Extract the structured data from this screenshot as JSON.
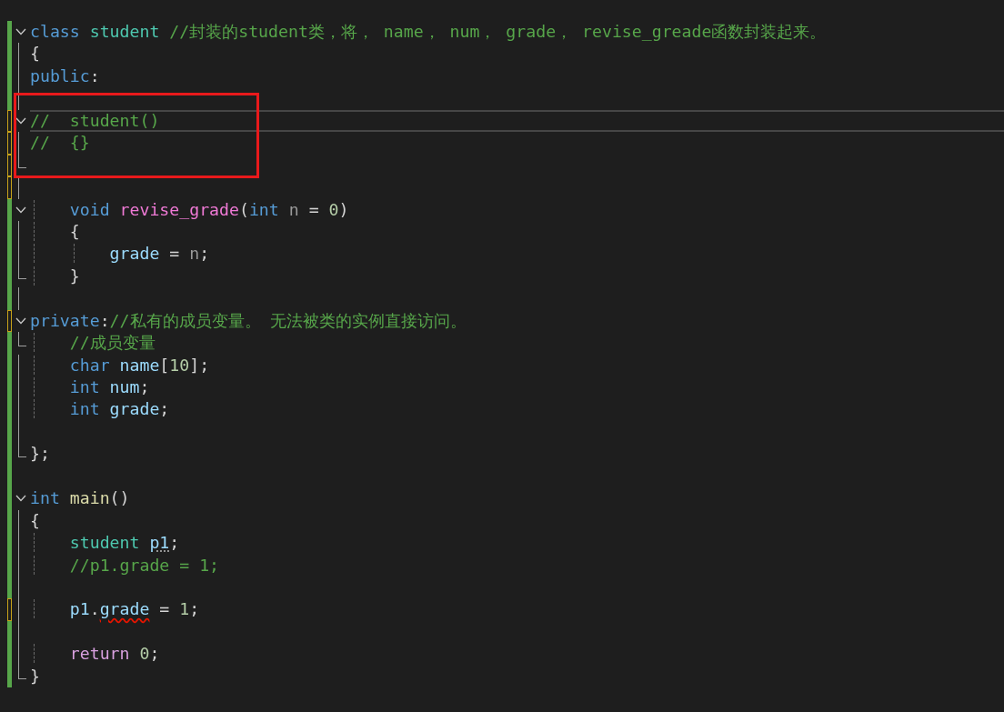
{
  "editor": {
    "lines": [
      {
        "kind": "head",
        "modified": false,
        "tokens": [
          {
            "text": "class",
            "kind": "keyword"
          },
          {
            "text": " student",
            "kind": "type"
          },
          {
            "text": " //封装的student类，将， name， num， grade， revise_greade函数封装起来。",
            "kind": "comment"
          }
        ]
      },
      {
        "kind": "body",
        "modified": false,
        "tokens": [
          {
            "text": "{",
            "kind": "punct"
          }
        ]
      },
      {
        "kind": "body",
        "modified": false,
        "tokens": [
          {
            "text": "public",
            "kind": "keyword"
          },
          {
            "text": ":",
            "kind": "punct"
          }
        ]
      },
      {
        "kind": "body",
        "modified": false,
        "boxed": true
      },
      {
        "kind": "head",
        "modified": true,
        "boxed": true,
        "current": true,
        "tokens": [
          {
            "text": "//  student()",
            "kind": "comment"
          }
        ]
      },
      {
        "kind": "body",
        "modified": true,
        "boxed": true,
        "tokens": [
          {
            "text": "//  {}",
            "kind": "comment"
          }
        ]
      },
      {
        "kind": "tail",
        "modified": true,
        "boxed": true
      },
      {
        "kind": "body",
        "modified": true
      },
      {
        "kind": "head",
        "modified": false,
        "tokens": [
          {
            "text": "    void",
            "kind": "keyword"
          },
          {
            "text": " revise_grade",
            "kind": "function"
          },
          {
            "text": "(",
            "kind": "punct"
          },
          {
            "text": "int",
            "kind": "keyword"
          },
          {
            "text": " n",
            "kind": "param"
          },
          {
            "text": " = ",
            "kind": "punct"
          },
          {
            "text": "0",
            "kind": "number"
          },
          {
            "text": ")",
            "kind": "punct"
          }
        ]
      },
      {
        "kind": "body",
        "modified": false,
        "tokens": [
          {
            "text": "    {",
            "kind": "punct"
          }
        ]
      },
      {
        "kind": "body",
        "modified": false,
        "tokens": [
          {
            "text": "        grade",
            "kind": "variable"
          },
          {
            "text": " = ",
            "kind": "punct"
          },
          {
            "text": "n",
            "kind": "param"
          },
          {
            "text": ";",
            "kind": "punct"
          }
        ]
      },
      {
        "kind": "tail",
        "modified": false,
        "tokens": [
          {
            "text": "    }",
            "kind": "punct"
          }
        ]
      },
      {
        "kind": "body",
        "modified": false
      },
      {
        "kind": "head",
        "modified": true,
        "tokens": [
          {
            "text": "private",
            "kind": "keyword"
          },
          {
            "text": ":",
            "kind": "punct"
          },
          {
            "text": "//私有的成员变量。 无法被类的实例直接访问。",
            "kind": "comment"
          }
        ]
      },
      {
        "kind": "tail",
        "modified": false,
        "tokens": [
          {
            "text": "    //成员变量",
            "kind": "comment"
          }
        ]
      },
      {
        "kind": "body",
        "modified": false,
        "tokens": [
          {
            "text": "    char",
            "kind": "keyword"
          },
          {
            "text": " name",
            "kind": "variable"
          },
          {
            "text": "[",
            "kind": "punct"
          },
          {
            "text": "10",
            "kind": "number"
          },
          {
            "text": "];",
            "kind": "punct"
          }
        ]
      },
      {
        "kind": "body",
        "modified": false,
        "tokens": [
          {
            "text": "    int",
            "kind": "keyword"
          },
          {
            "text": " num",
            "kind": "variable"
          },
          {
            "text": ";",
            "kind": "punct"
          }
        ]
      },
      {
        "kind": "body",
        "modified": false,
        "tokens": [
          {
            "text": "    int",
            "kind": "keyword"
          },
          {
            "text": " grade",
            "kind": "variable"
          },
          {
            "text": ";",
            "kind": "punct"
          }
        ]
      },
      {
        "kind": "body",
        "modified": false
      },
      {
        "kind": "tail",
        "modified": false,
        "tokens": [
          {
            "text": "};",
            "kind": "punct"
          }
        ]
      },
      {
        "kind": "plain",
        "modified": false
      },
      {
        "kind": "head",
        "modified": false,
        "tokens": [
          {
            "text": "int",
            "kind": "keyword"
          },
          {
            "text": " main",
            "kind": "method"
          },
          {
            "text": "()",
            "kind": "punct"
          }
        ]
      },
      {
        "kind": "body",
        "modified": false,
        "tokens": [
          {
            "text": "{",
            "kind": "punct"
          }
        ]
      },
      {
        "kind": "body",
        "modified": false,
        "tokens": [
          {
            "text": "    student ",
            "kind": "type"
          },
          {
            "text": "p1",
            "kind": "variable",
            "hint": true
          },
          {
            "text": ";",
            "kind": "punct"
          }
        ]
      },
      {
        "kind": "body",
        "modified": false,
        "tokens": [
          {
            "text": "    //p1.grade = 1;",
            "kind": "comment"
          }
        ]
      },
      {
        "kind": "body",
        "modified": false
      },
      {
        "kind": "body",
        "modified": true,
        "tokens": [
          {
            "text": "    p1",
            "kind": "variable"
          },
          {
            "text": ".",
            "kind": "punct"
          },
          {
            "text": "grade",
            "kind": "variable",
            "error": true
          },
          {
            "text": " = ",
            "kind": "punct"
          },
          {
            "text": "1",
            "kind": "number"
          },
          {
            "text": ";",
            "kind": "punct"
          }
        ]
      },
      {
        "kind": "body",
        "modified": false
      },
      {
        "kind": "body",
        "modified": false,
        "tokens": [
          {
            "text": "    return",
            "kind": "control"
          },
          {
            "text": " 0",
            "kind": "number"
          },
          {
            "text": ";",
            "kind": "punct"
          }
        ]
      },
      {
        "kind": "tail",
        "modified": false,
        "tokens": [
          {
            "text": "}",
            "kind": "punct"
          }
        ]
      }
    ]
  }
}
